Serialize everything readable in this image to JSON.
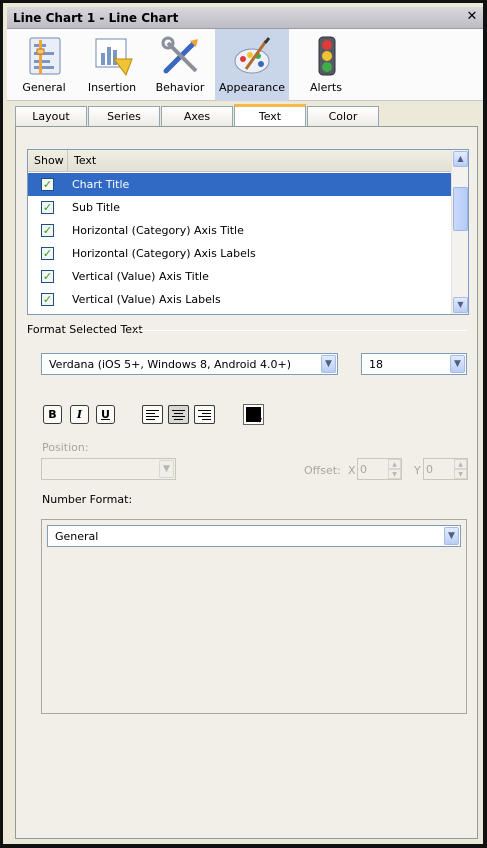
{
  "window": {
    "title": "Line Chart 1 - Line Chart",
    "close_glyph": "✕"
  },
  "icon_tabs": [
    {
      "label": "General",
      "icon": "general-settings-icon",
      "active": false
    },
    {
      "label": "Insertion",
      "icon": "insertion-icon",
      "active": false
    },
    {
      "label": "Behavior",
      "icon": "behavior-tools-icon",
      "active": false
    },
    {
      "label": "Appearance",
      "icon": "appearance-palette-icon",
      "active": true
    },
    {
      "label": "Alerts",
      "icon": "traffic-light-icon",
      "active": false
    }
  ],
  "sub_tabs": [
    {
      "label": "Layout",
      "active": false
    },
    {
      "label": "Series",
      "active": false
    },
    {
      "label": "Axes",
      "active": false
    },
    {
      "label": "Text",
      "active": true
    },
    {
      "label": "Color",
      "active": false
    }
  ],
  "text_list": {
    "headers": {
      "show": "Show",
      "text": "Text"
    },
    "rows": [
      {
        "checked": true,
        "text": "Chart Title",
        "selected": true
      },
      {
        "checked": true,
        "text": "Sub Title",
        "selected": false
      },
      {
        "checked": true,
        "text": "Horizontal (Category) Axis Title",
        "selected": false
      },
      {
        "checked": true,
        "text": "Horizontal (Category) Axis Labels",
        "selected": false
      },
      {
        "checked": true,
        "text": "Vertical (Value) Axis Title",
        "selected": false
      },
      {
        "checked": true,
        "text": "Vertical (Value) Axis Labels",
        "selected": false
      }
    ]
  },
  "format": {
    "section_label": "Format Selected Text",
    "font": "Verdana (iOS 5+, Windows 8, Android 4.0+)",
    "size": "18",
    "bold": "B",
    "italic": "I",
    "underline": "U",
    "alignment": "center",
    "color": "#000000",
    "position_label": "Position:",
    "position_value": "",
    "offset_label": "Offset:",
    "offset_x_label": "X",
    "offset_x": "0",
    "offset_y_label": "Y",
    "offset_y": "0",
    "number_format_label": "Number Format:",
    "number_format": "General"
  }
}
